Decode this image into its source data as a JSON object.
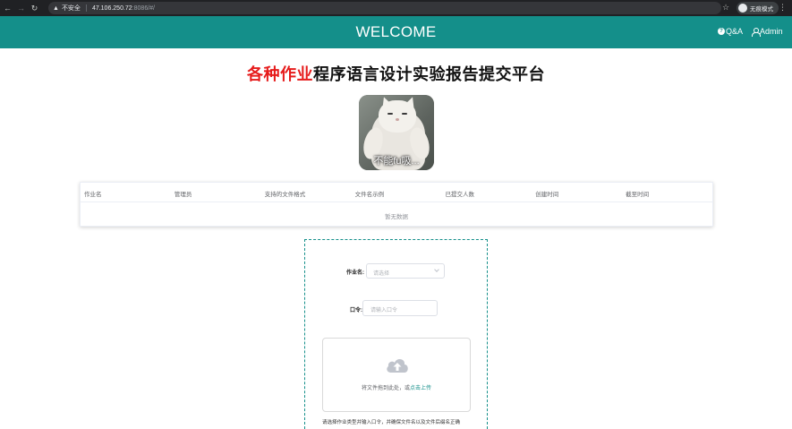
{
  "browser": {
    "security_label": "不安全",
    "url_host": "47.106.250.72",
    "url_path": ":8086/#/",
    "incognito_label": "无痕模式"
  },
  "header": {
    "title": "WELCOME",
    "qa_label": "Q&A",
    "admin_label": "Admin"
  },
  "page": {
    "title_red": "各种作业",
    "title_rest": "程序语言设计实验报告提交平台",
    "meme_caption": "不能fu吸..."
  },
  "table": {
    "columns": [
      "作业名",
      "管理员",
      "支持的文件格式",
      "文件名示例",
      "已提交人数",
      "创建时间",
      "截至时间"
    ],
    "empty_text": "暂无数据"
  },
  "form": {
    "assignment_label": "作业名:",
    "assignment_placeholder": "请选择",
    "password_label": "口令:",
    "password_placeholder": "请输入口令",
    "drop_text": "将文件拖到此处，或",
    "drop_link": "点击上传",
    "hint": "请选择作业类型并输入口令，并确保文件名以及文件后缀名正确"
  },
  "colors": {
    "header_bg": "#148f8a",
    "accent_red": "#e61b1b"
  }
}
